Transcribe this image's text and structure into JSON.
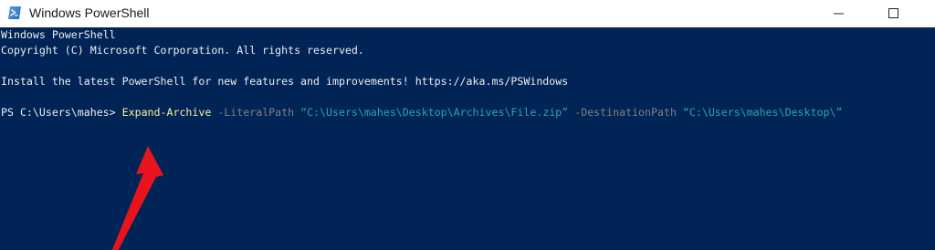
{
  "window": {
    "title": "Windows PowerShell",
    "icon": "powershell-icon"
  },
  "controls": {
    "minimize_icon": "minimize-icon",
    "maximize_icon": "maximize-icon"
  },
  "console": {
    "background": "#012456",
    "banner_line1": "Windows PowerShell",
    "banner_line2": "Copyright (C) Microsoft Corporation. All rights reserved.",
    "install_line": "Install the latest PowerShell for new features and improvements! https://aka.ms/PSWindows",
    "prompt": "PS C:\\Users\\mahes> ",
    "cmdlet": "Expand-Archive",
    "param1": " -LiteralPath ",
    "value1": "“C:\\Users\\mahes\\Desktop\\Archives\\File.zip”",
    "param2": " -DestinationPath ",
    "value2": "“C:\\Users\\mahes\\Desktop\\”"
  },
  "annotation": {
    "arrow_color": "#e8141d",
    "icon": "red-arrow-icon"
  }
}
